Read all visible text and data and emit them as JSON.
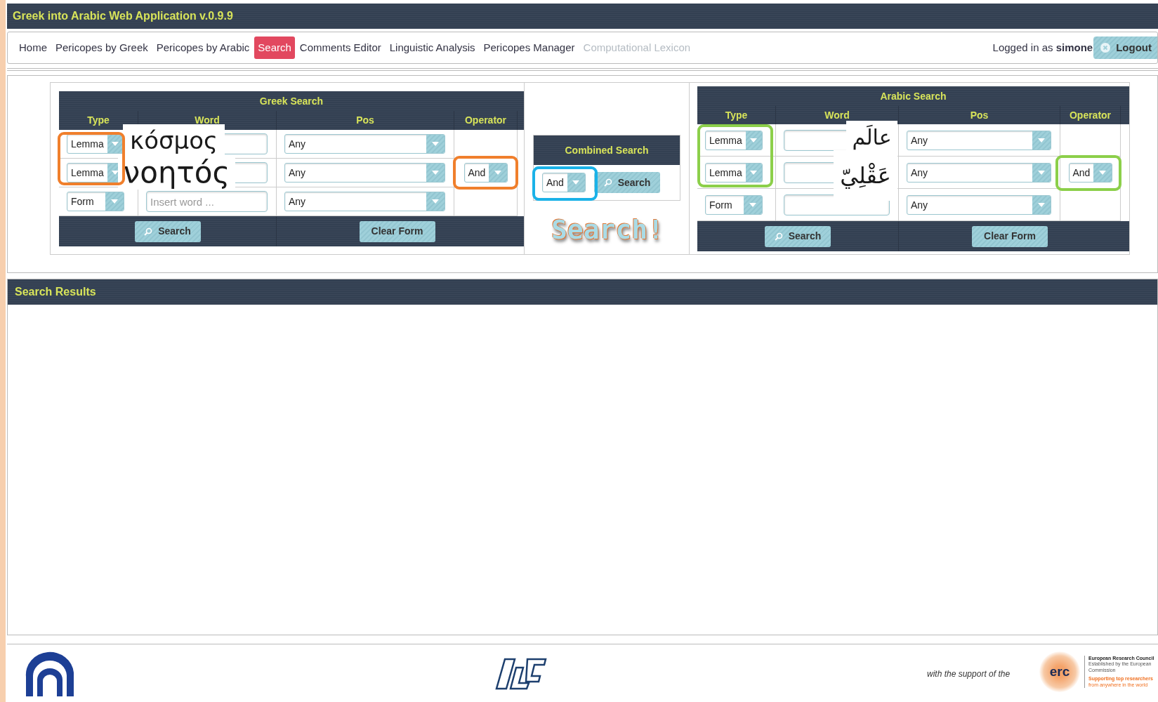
{
  "app_title": "Greek into Arabic Web Application v.0.9.9",
  "nav": {
    "items": [
      {
        "label": "Home",
        "selected": false,
        "disabled": false
      },
      {
        "label": "Pericopes by Greek",
        "selected": false,
        "disabled": false
      },
      {
        "label": "Pericopes by Arabic",
        "selected": false,
        "disabled": false
      },
      {
        "label": "Search",
        "selected": true,
        "disabled": false
      },
      {
        "label": "Comments Editor",
        "selected": false,
        "disabled": false
      },
      {
        "label": "Linguistic Analysis",
        "selected": false,
        "disabled": false
      },
      {
        "label": "Pericopes Manager",
        "selected": false,
        "disabled": false
      },
      {
        "label": "Computational Lexicon",
        "selected": false,
        "disabled": true
      }
    ],
    "login_prefix": "Logged in as",
    "user": "simone",
    "logout": "Logout"
  },
  "greek_search": {
    "title": "Greek Search",
    "columns": [
      "Type",
      "Word",
      "Pos",
      "Operator"
    ],
    "rows": [
      {
        "type": "Lemma",
        "pos": "Any"
      },
      {
        "type": "Lemma",
        "pos": "Any",
        "operator": "And"
      },
      {
        "type": "Form",
        "word_placeholder": "Insert word ...",
        "pos": "Any"
      }
    ],
    "buttons": [
      "Search",
      "Clear Form"
    ]
  },
  "combined_search": {
    "title": "Combined Search",
    "operator": "And",
    "button": "Search"
  },
  "arabic_search": {
    "title": "Arabic Search",
    "columns": [
      "Type",
      "Word",
      "Pos",
      "Operator"
    ],
    "rows": [
      {
        "type": "Lemma",
        "pos": "Any"
      },
      {
        "type": "Lemma",
        "pos": "Any",
        "operator": "And"
      },
      {
        "type": "Form",
        "pos": "Any"
      }
    ],
    "buttons": [
      "Search",
      "Clear Form"
    ]
  },
  "search_results": {
    "title": "Search Results"
  },
  "footer": {
    "support_text": "with the support of the",
    "erc": {
      "mark": "erc",
      "name": "European Research Council",
      "subtitle": "Established by the European Commission",
      "tagline": "Supporting top researchers",
      "tagline2": "from anywhere in the world"
    }
  },
  "annotations": [
    {
      "kind": "label",
      "text": "κόσμος"
    },
    {
      "kind": "label",
      "text": "νοητός"
    },
    {
      "kind": "outline",
      "color": "#f07f2c"
    },
    {
      "kind": "outline",
      "color": "#f07f2c"
    },
    {
      "kind": "outline",
      "color": "#1ab2e8"
    },
    {
      "kind": "label",
      "text": "عالَم"
    },
    {
      "kind": "label",
      "text": "عَقْلِيّ"
    },
    {
      "kind": "outline",
      "color": "#8ccf4a"
    },
    {
      "kind": "outline",
      "color": "#8ccf4a"
    },
    {
      "kind": "callout",
      "text": "Search!"
    }
  ]
}
